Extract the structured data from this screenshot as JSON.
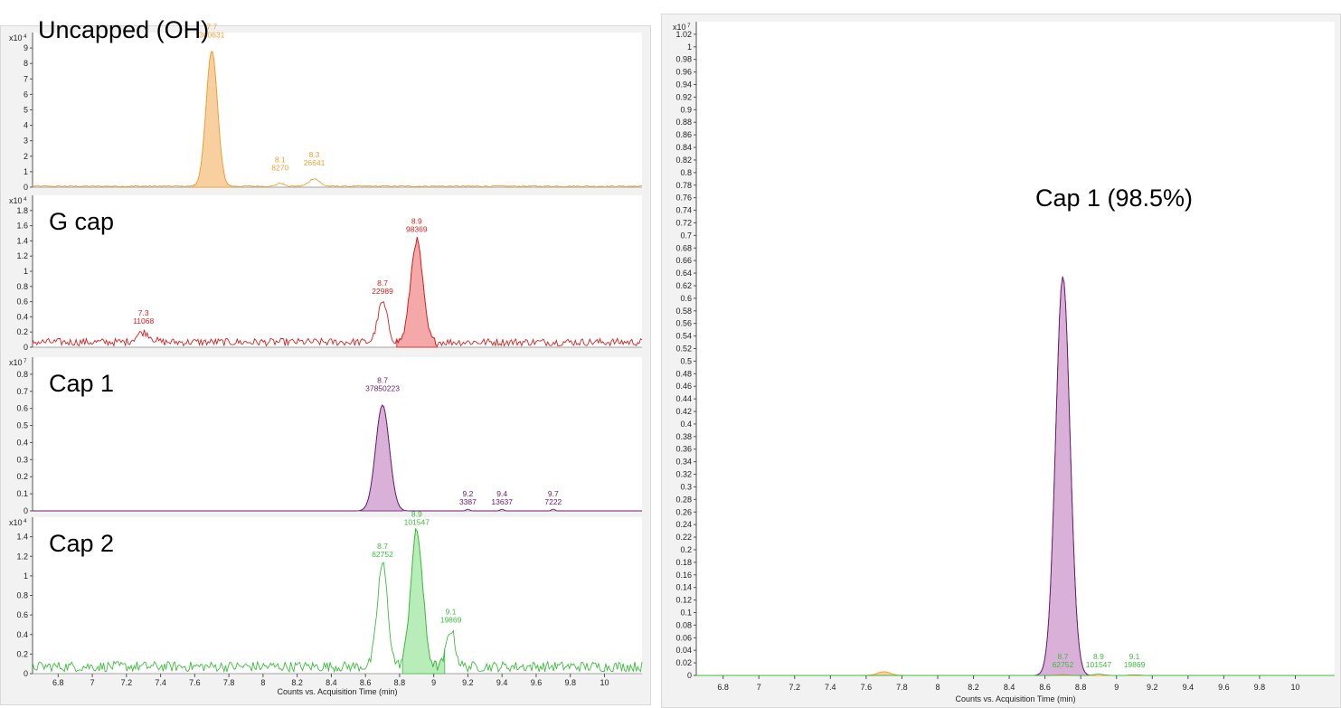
{
  "chart_data": [
    {
      "id": "uncapped",
      "type": "line",
      "label": "Uncapped (OH)",
      "color": "#f0a030",
      "fill": "#f8d0a0",
      "scale": "x10 4",
      "ylim": [
        0,
        10
      ],
      "yticks": [
        0,
        1,
        2,
        3,
        4,
        5,
        6,
        7,
        8,
        9
      ],
      "noise": 0.12,
      "peaks": [
        {
          "rt": 7.7,
          "height": 8.8,
          "width": 0.033,
          "area": "360631",
          "filled": true,
          "fill_range": [
            7.59,
            7.82
          ]
        },
        {
          "rt": 8.1,
          "height": 0.2,
          "width": 0.02,
          "area": "8270",
          "filled": false
        },
        {
          "rt": 8.3,
          "height": 0.5,
          "width": 0.03,
          "area": "26641",
          "filled": false
        }
      ]
    },
    {
      "id": "gcap",
      "type": "line",
      "label": "G cap",
      "color": "#d42020",
      "fill": "#f5a8a8",
      "scale": "x10 4",
      "ylim": [
        0,
        2
      ],
      "yticks": [
        0,
        0.2,
        0.4,
        0.6,
        0.8,
        1,
        1.2,
        1.4,
        1.6,
        1.8
      ],
      "noise": 0.13,
      "peaks": [
        {
          "rt": 7.3,
          "height": 0.13,
          "width": 0.04,
          "area": "11068",
          "filled": false
        },
        {
          "rt": 8.7,
          "height": 0.52,
          "width": 0.028,
          "area": "22989",
          "filled": false
        },
        {
          "rt": 8.9,
          "height": 1.34,
          "width": 0.035,
          "area": "98369",
          "filled": true,
          "fill_range": [
            8.78,
            9.03
          ]
        }
      ]
    },
    {
      "id": "cap1",
      "type": "line",
      "label": "Cap 1",
      "color": "#6a1a6a",
      "fill": "#d8b0d8",
      "scale": "x10 7",
      "ylim": [
        0,
        0.9
      ],
      "yticks": [
        0,
        0.1,
        0.2,
        0.3,
        0.4,
        0.5,
        0.6,
        0.7,
        0.8
      ],
      "noise": 0.0,
      "peaks": [
        {
          "rt": 8.7,
          "height": 0.62,
          "width": 0.04,
          "area": "37850223",
          "filled": true,
          "fill_range": [
            8.57,
            8.82
          ]
        },
        {
          "rt": 9.2,
          "height": 0.01,
          "width": 0.01,
          "area": "3387",
          "filled": false
        },
        {
          "rt": 9.4,
          "height": 0.01,
          "width": 0.01,
          "area": "13637",
          "filled": false
        },
        {
          "rt": 9.7,
          "height": 0.01,
          "width": 0.01,
          "area": "7222",
          "filled": false
        }
      ]
    },
    {
      "id": "cap2",
      "type": "line",
      "label": "Cap 2",
      "color": "#3cbc3c",
      "fill": "#b8ecb8",
      "scale": "x10 4",
      "ylim": [
        0,
        1.6
      ],
      "yticks": [
        0,
        0.2,
        0.4,
        0.6,
        0.8,
        1,
        1.2,
        1.4
      ],
      "noise": 0.14,
      "peaks": [
        {
          "rt": 8.7,
          "height": 1.05,
          "width": 0.03,
          "area": "62752",
          "filled": false
        },
        {
          "rt": 8.9,
          "height": 1.38,
          "width": 0.035,
          "area": "101547",
          "filled": true,
          "fill_range": [
            8.81,
            9.07
          ]
        },
        {
          "rt": 9.1,
          "height": 0.38,
          "width": 0.025,
          "area": "19869",
          "filled": false
        }
      ]
    },
    {
      "id": "overlay",
      "type": "line",
      "label": "Cap 1 (98.5%)",
      "scale": "x10 7",
      "ylim": [
        0,
        1.04
      ],
      "yticks": [
        0,
        0.02,
        0.04,
        0.06,
        0.08,
        0.1,
        0.12,
        0.14,
        0.16,
        0.18,
        0.2,
        0.22,
        0.24,
        0.26,
        0.28,
        0.3,
        0.32,
        0.34,
        0.36,
        0.38,
        0.4,
        0.42,
        0.44,
        0.46,
        0.48,
        0.5,
        0.52,
        0.54,
        0.56,
        0.58,
        0.6,
        0.62,
        0.64,
        0.66,
        0.68,
        0.7,
        0.72,
        0.74,
        0.76,
        0.78,
        0.8,
        0.82,
        0.84,
        0.86,
        0.88,
        0.9,
        0.92,
        0.94,
        0.96,
        0.98,
        1,
        1.02
      ],
      "series": [
        {
          "color": "#6a1a6a",
          "fill": "#d8b0d8",
          "peaks": [
            {
              "rt": 8.7,
              "height": 0.635,
              "width": 0.04,
              "filled": true,
              "fill_range": [
                8.55,
                8.84
              ]
            }
          ]
        },
        {
          "color": "#f0a030",
          "fill": "#f8d0a0",
          "peaks": [
            {
              "rt": 7.7,
              "height": 0.006,
              "width": 0.035,
              "filled": true,
              "fill_range": [
                7.6,
                7.8
              ]
            }
          ]
        },
        {
          "color": "#3cbc3c",
          "fill": "#b8ecb8",
          "peaks": [
            {
              "rt": 8.7,
              "height": 0.001,
              "width": 0.03,
              "area": "62752",
              "filled": false
            },
            {
              "rt": 8.9,
              "height": 0.002,
              "width": 0.03,
              "area": "101547",
              "filled": false
            },
            {
              "rt": 9.1,
              "height": 0.001,
              "width": 0.03,
              "area": "19869",
              "filled": false
            }
          ]
        }
      ]
    }
  ],
  "x_axis": {
    "xlabel": "Counts vs. Acquisition Time (min)",
    "xlim": [
      6.65,
      10.22
    ],
    "ticks": [
      6.8,
      7,
      7.2,
      7.4,
      7.6,
      7.8,
      8,
      8.2,
      8.4,
      8.6,
      8.8,
      9,
      9.2,
      9.4,
      9.6,
      9.8,
      10
    ]
  }
}
